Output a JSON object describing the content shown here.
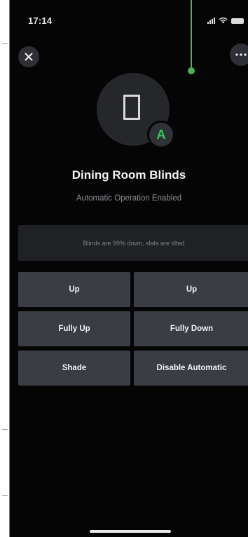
{
  "status_bar": {
    "time": "17:14"
  },
  "header": {
    "close_icon": "close-icon",
    "more_icon": "more-horizontal-icon"
  },
  "device": {
    "icon": "blind-window-icon",
    "badge_letter": "A",
    "name": "Dining Room Blinds",
    "mode": "Automatic Operation Enabled",
    "status": "Blinds are 99% down, slats are tilted"
  },
  "controls": {
    "up_left": "Up",
    "up_right": "Up",
    "fully_up": "Fully Up",
    "fully_down": "Fully Down",
    "shade": "Shade",
    "disable_automatic": "Disable Automatic"
  },
  "colors": {
    "background": "#050505",
    "button": "#3a3e44",
    "panel": "#1f2125",
    "accent": "#3ec45a",
    "callout": "#4caf50"
  }
}
